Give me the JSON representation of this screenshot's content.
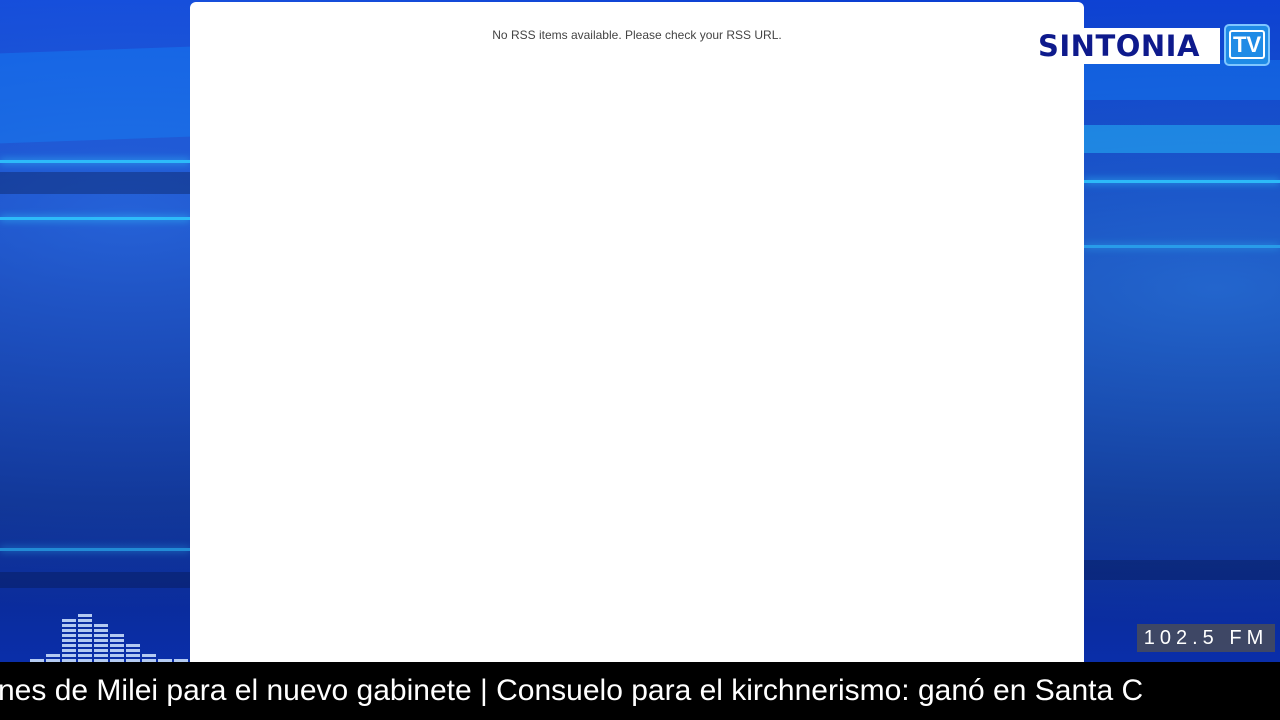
{
  "panel": {
    "message": "No RSS items available. Please check your RSS URL."
  },
  "logo": {
    "brand": "SINTONIA",
    "badge": "TV"
  },
  "radio": {
    "frequency": "102.5 FM"
  },
  "ticker": {
    "text": "nes de Milei para el nuevo gabinete | Consuelo para el kirchnerismo: ganó en Santa C"
  },
  "icons": {
    "equalizer": "equalizer-bars-icon"
  },
  "colors": {
    "background": "#0b2fa0",
    "accent_streak": "#2fc6ff",
    "logo_text": "#0e1a8c",
    "logo_badge": "#1f8be6",
    "ticker_bg": "#000000"
  }
}
